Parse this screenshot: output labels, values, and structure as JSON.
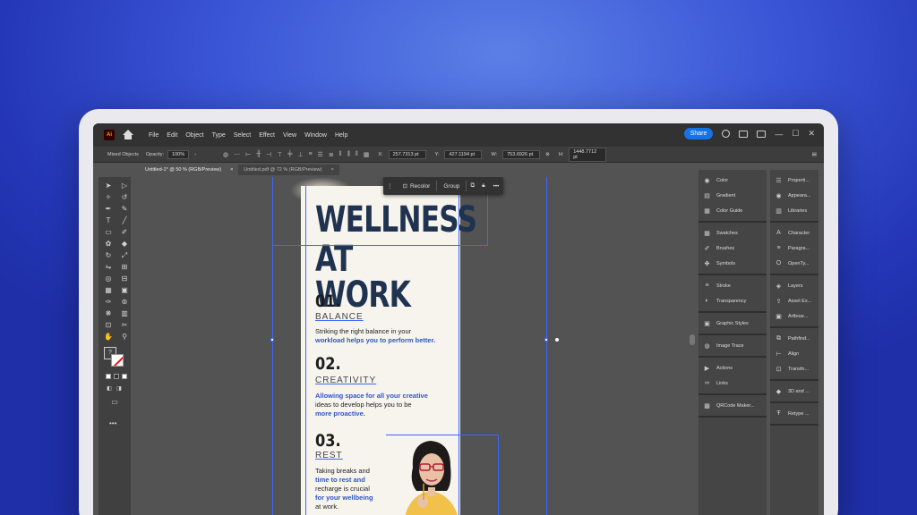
{
  "app": {
    "logo": "Ai",
    "menu": [
      "File",
      "Edit",
      "Object",
      "Type",
      "Select",
      "Effect",
      "View",
      "Window",
      "Help"
    ],
    "share_label": "Share"
  },
  "controlbar": {
    "selection_label": "Mixed Objects",
    "opacity_label": "Opacity:",
    "opacity_value": "100%",
    "x_label": "X:",
    "x_value": "257.7313 pt",
    "y_label": "Y:",
    "y_value": "427.1194 pt",
    "w_label": "W:",
    "w_value": "753.6926 pt",
    "h_label": "H:",
    "h_value": "1448.7712 pt"
  },
  "tabs": [
    {
      "label": "Untitled-1* @ 50 % (RGB/Preview)",
      "close": "×"
    },
    {
      "label": "Untitled.pdf @ 72 % (RGB/Preview)",
      "close": "×"
    }
  ],
  "float_toolbar": {
    "recolor_label": "Recolor",
    "group_label": "Group",
    "more_label": "•••"
  },
  "artboard": {
    "title_line1": "WELLNESS",
    "title_line2": "AT WORK",
    "sections": [
      {
        "number": "01.",
        "title": "BALANCE",
        "line1": "Striking the right balance in your",
        "line2": "workload helps you to perform better."
      },
      {
        "number": "02.",
        "title": "CREATIVITY",
        "line1": "Allowing space for all your creative",
        "line2": "ideas to develop helps you to be",
        "line3": "more proactive."
      },
      {
        "number": "03.",
        "title": "REST",
        "line1": "Taking breaks and",
        "line2": "time to rest and",
        "line3": "recharge is crucial",
        "line4": "for your wellbeing",
        "line5": "at work."
      }
    ]
  },
  "panels_left": [
    {
      "group": [
        {
          "label": "Color",
          "icon": "color-wheel-icon"
        },
        {
          "label": "Gradient",
          "icon": "gradient-icon"
        },
        {
          "label": "Color Guide",
          "icon": "color-guide-icon"
        }
      ]
    },
    {
      "group": [
        {
          "label": "Swatches",
          "icon": "swatches-icon"
        },
        {
          "label": "Brushes",
          "icon": "brushes-icon"
        },
        {
          "label": "Symbols",
          "icon": "symbols-icon"
        }
      ]
    },
    {
      "group": [
        {
          "label": "Stroke",
          "icon": "stroke-icon"
        },
        {
          "label": "Transparency",
          "icon": "transparency-icon"
        }
      ]
    },
    {
      "group": [
        {
          "label": "Graphic Styles",
          "icon": "graphic-styles-icon"
        }
      ]
    },
    {
      "group": [
        {
          "label": "Image Trace",
          "icon": "image-trace-icon"
        }
      ]
    },
    {
      "group": [
        {
          "label": "Actions",
          "icon": "actions-icon"
        },
        {
          "label": "Links",
          "icon": "links-icon"
        }
      ]
    },
    {
      "group": [
        {
          "label": "QRCode Maker...",
          "icon": "qrcode-icon"
        }
      ]
    }
  ],
  "panels_right": [
    {
      "group": [
        {
          "label": "Properti...",
          "icon": "properties-icon"
        },
        {
          "label": "Appeara...",
          "icon": "appearance-icon"
        },
        {
          "label": "Libraries",
          "icon": "libraries-icon"
        }
      ]
    },
    {
      "group": [
        {
          "label": "Character",
          "icon": "character-icon"
        },
        {
          "label": "Paragra...",
          "icon": "paragraph-icon"
        },
        {
          "label": "OpenTy...",
          "icon": "opentype-icon"
        }
      ]
    },
    {
      "group": [
        {
          "label": "Layers",
          "icon": "layers-icon"
        },
        {
          "label": "Asset Ex...",
          "icon": "asset-export-icon"
        },
        {
          "label": "Artboar...",
          "icon": "artboards-icon"
        }
      ]
    },
    {
      "group": [
        {
          "label": "Pathfind...",
          "icon": "pathfinder-icon"
        },
        {
          "label": "Align",
          "icon": "align-icon"
        },
        {
          "label": "Transfo...",
          "icon": "transform-icon"
        }
      ]
    },
    {
      "group": [
        {
          "label": "3D and ...",
          "icon": "3d-icon"
        }
      ]
    },
    {
      "group": [
        {
          "label": "Retype ...",
          "icon": "retype-icon"
        }
      ]
    }
  ]
}
